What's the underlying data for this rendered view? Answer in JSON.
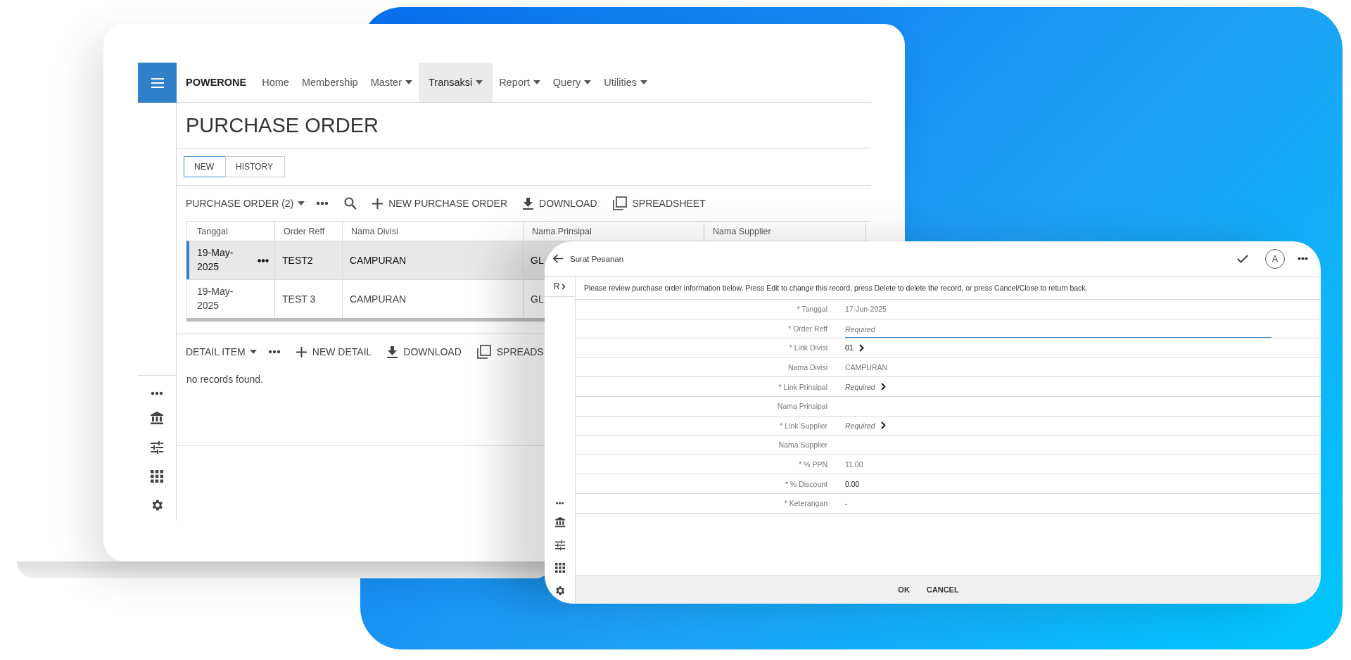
{
  "app": {
    "brand": "POWERONE",
    "nav": [
      {
        "label": "Home",
        "dropdown": false,
        "selected": false
      },
      {
        "label": "Membership",
        "dropdown": false,
        "selected": false
      },
      {
        "label": "Master",
        "dropdown": true,
        "selected": false
      },
      {
        "label": "Transaksi",
        "dropdown": true,
        "selected": true
      },
      {
        "label": "Report",
        "dropdown": true,
        "selected": false
      },
      {
        "label": "Query",
        "dropdown": true,
        "selected": false
      },
      {
        "label": "Utilities",
        "dropdown": true,
        "selected": false
      }
    ],
    "page_title": "PURCHASE ORDER",
    "steps": [
      {
        "label": "NEW",
        "selected": true
      },
      {
        "label": "HISTORY",
        "selected": false
      }
    ],
    "toolbar": {
      "title": "PURCHASE ORDER (2)",
      "actions": [
        {
          "kind": "more"
        },
        {
          "kind": "search"
        },
        {
          "kind": "add",
          "label": "NEW PURCHASE ORDER"
        },
        {
          "kind": "download",
          "label": "DOWNLOAD"
        },
        {
          "kind": "spreadsheet",
          "label": "SPREADSHEET"
        }
      ]
    },
    "table": {
      "columns": [
        "Tanggal",
        "Order Reff",
        "Nama Divisi",
        "Nama Prinsipal",
        "Nama Supplier"
      ],
      "rows": [
        {
          "selected": true,
          "cells": [
            "19-May-2025",
            "TEST2",
            "CAMPURAN",
            "GL"
          ]
        },
        {
          "selected": false,
          "cells": [
            "19-May-2025",
            "TEST 3",
            "CAMPURAN",
            "GL"
          ]
        }
      ]
    },
    "detail_toolbar": {
      "title": "DETAIL ITEM",
      "actions": [
        {
          "kind": "more"
        },
        {
          "kind": "add",
          "label": "NEW DETAIL"
        },
        {
          "kind": "download",
          "label": "DOWNLOAD"
        },
        {
          "kind": "spreadsheet",
          "label": "SPREADS"
        }
      ]
    },
    "empty_message": "no records found."
  },
  "dialog": {
    "title": "Surat Pesanan",
    "avatar": "A",
    "rail_label": "R",
    "message": "Please review purchase order information below. Press Edit to change this record, press Delete to delete the record, or press Cancel/Close to return back.",
    "fields": [
      {
        "label": "* Tanggal",
        "kind": "readonly",
        "value": "17-Jun-2025"
      },
      {
        "label": "* Order Reff",
        "kind": "input",
        "placeholder": "Required"
      },
      {
        "label": "* Link Divisi",
        "kind": "link",
        "value": "01"
      },
      {
        "label": "Nama Divisi",
        "kind": "readonly",
        "value": "CAMPURAN"
      },
      {
        "label": "* Link Prinsipal",
        "kind": "link",
        "placeholder": "Required"
      },
      {
        "label": "Nama Prinsipal",
        "kind": "readonly"
      },
      {
        "label": "* Link Supplier",
        "kind": "link",
        "placeholder": "Required"
      },
      {
        "label": "Nama Supplier",
        "kind": "readonly"
      },
      {
        "label": "* % PPN",
        "kind": "readonly",
        "value": "11.00"
      },
      {
        "label": "* % Discount",
        "kind": "editable",
        "value": "0.00"
      },
      {
        "label": "* Keterangan",
        "kind": "editable",
        "value": "-"
      }
    ],
    "buttons": [
      "OK",
      "CANCEL"
    ]
  }
}
